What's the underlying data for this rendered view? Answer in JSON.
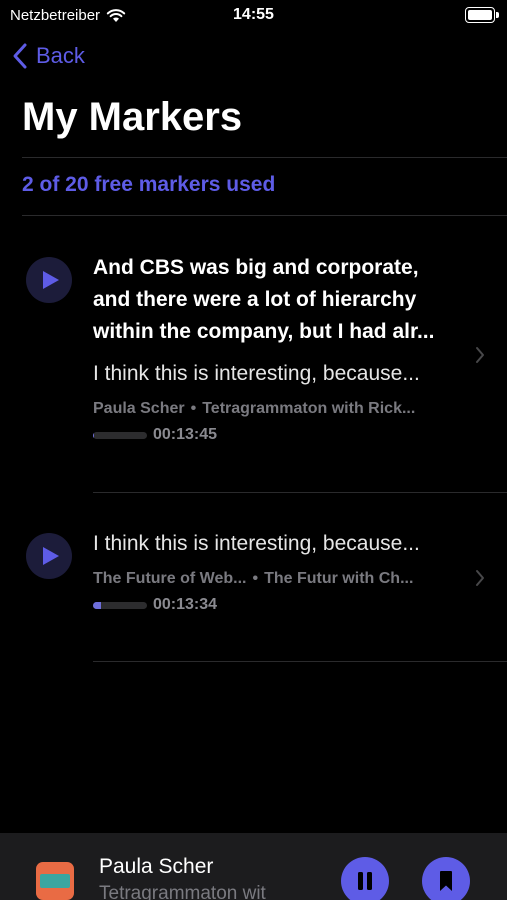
{
  "status_bar": {
    "carrier": "Netzbetreiber",
    "time": "14:55"
  },
  "nav": {
    "back_label": "Back"
  },
  "page": {
    "title": "My Markers",
    "usage_text": "2 of 20 free markers used"
  },
  "markers": [
    {
      "quote": "And CBS was big and corporate, and there were a lot of hierarchy within the company, but I had alr...",
      "note": "I think this is interesting, because...",
      "guest": "Paula Scher",
      "episode": "Tetragrammaton with Rick...",
      "timestamp": "00:13:45",
      "progress_percent": 2
    },
    {
      "quote": "",
      "note": "I think this is interesting, because...",
      "guest": "The Future of Web...",
      "episode": "The Futur with Ch...",
      "timestamp": "00:13:34",
      "progress_percent": 15
    }
  ],
  "mini_player": {
    "title": "Paula Scher",
    "subtitle": "Tetragrammaton wit"
  },
  "colors": {
    "accent": "#5e5ce6",
    "background": "#000000",
    "secondary_text": "#7a7a80"
  },
  "icons": {
    "back": "chevron-left-icon",
    "play": "play-icon",
    "pause": "pause-icon",
    "bookmark": "bookmark-icon",
    "row_chevron": "chevron-right-icon",
    "wifi": "wifi-icon",
    "battery": "battery-icon"
  }
}
